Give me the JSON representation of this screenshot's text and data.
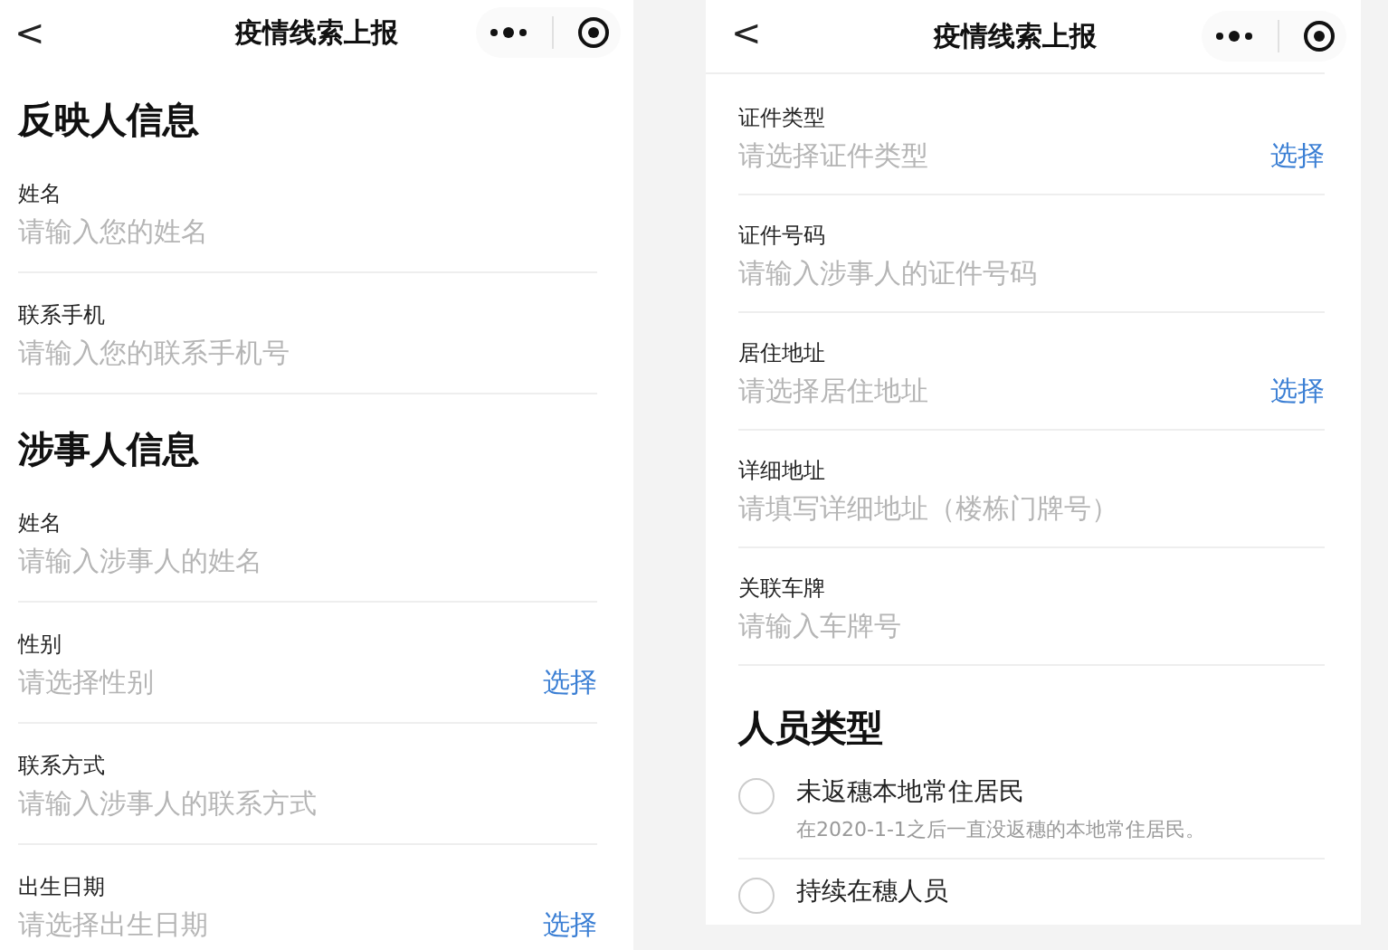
{
  "screens": [
    {
      "nav": {
        "back": "<",
        "title": "疫情线索上报"
      },
      "sections": [
        {
          "title": "反映人信息",
          "items": [
            {
              "kind": "field",
              "label": "姓名",
              "placeholder": "请输入您的姓名"
            },
            {
              "kind": "field",
              "label": "联系手机",
              "placeholder": "请输入您的联系手机号"
            }
          ]
        },
        {
          "title": "涉事人信息",
          "items": [
            {
              "kind": "field",
              "label": "姓名",
              "placeholder": "请输入涉事人的姓名"
            },
            {
              "kind": "field",
              "label": "性别",
              "placeholder": "请选择性别",
              "action": "选择"
            },
            {
              "kind": "field",
              "label": "联系方式",
              "placeholder": "请输入涉事人的联系方式"
            },
            {
              "kind": "field",
              "label": "出生日期",
              "placeholder": "请选择出生日期",
              "action": "选择"
            }
          ]
        }
      ]
    },
    {
      "nav": {
        "back": "<",
        "title": "疫情线索上报"
      },
      "sections": [
        {
          "items": [
            {
              "kind": "field",
              "label": "证件类型",
              "placeholder": "请选择证件类型",
              "action": "选择"
            },
            {
              "kind": "field",
              "label": "证件号码",
              "placeholder": "请输入涉事人的证件号码"
            },
            {
              "kind": "field",
              "label": "居住地址",
              "placeholder": "请选择居住地址",
              "action": "选择"
            },
            {
              "kind": "field",
              "label": "详细地址",
              "placeholder": "请填写详细地址（楼栋门牌号）"
            },
            {
              "kind": "field",
              "label": "关联车牌",
              "placeholder": "请输入车牌号"
            }
          ]
        },
        {
          "title": "人员类型",
          "items": [
            {
              "kind": "radio",
              "label": "未返穗本地常住居民",
              "note": "在2020-1-1之后一直没返穗的本地常住居民。",
              "selected": false
            },
            {
              "kind": "radio",
              "label": "持续在穗人员",
              "selected": false
            }
          ]
        }
      ]
    }
  ]
}
